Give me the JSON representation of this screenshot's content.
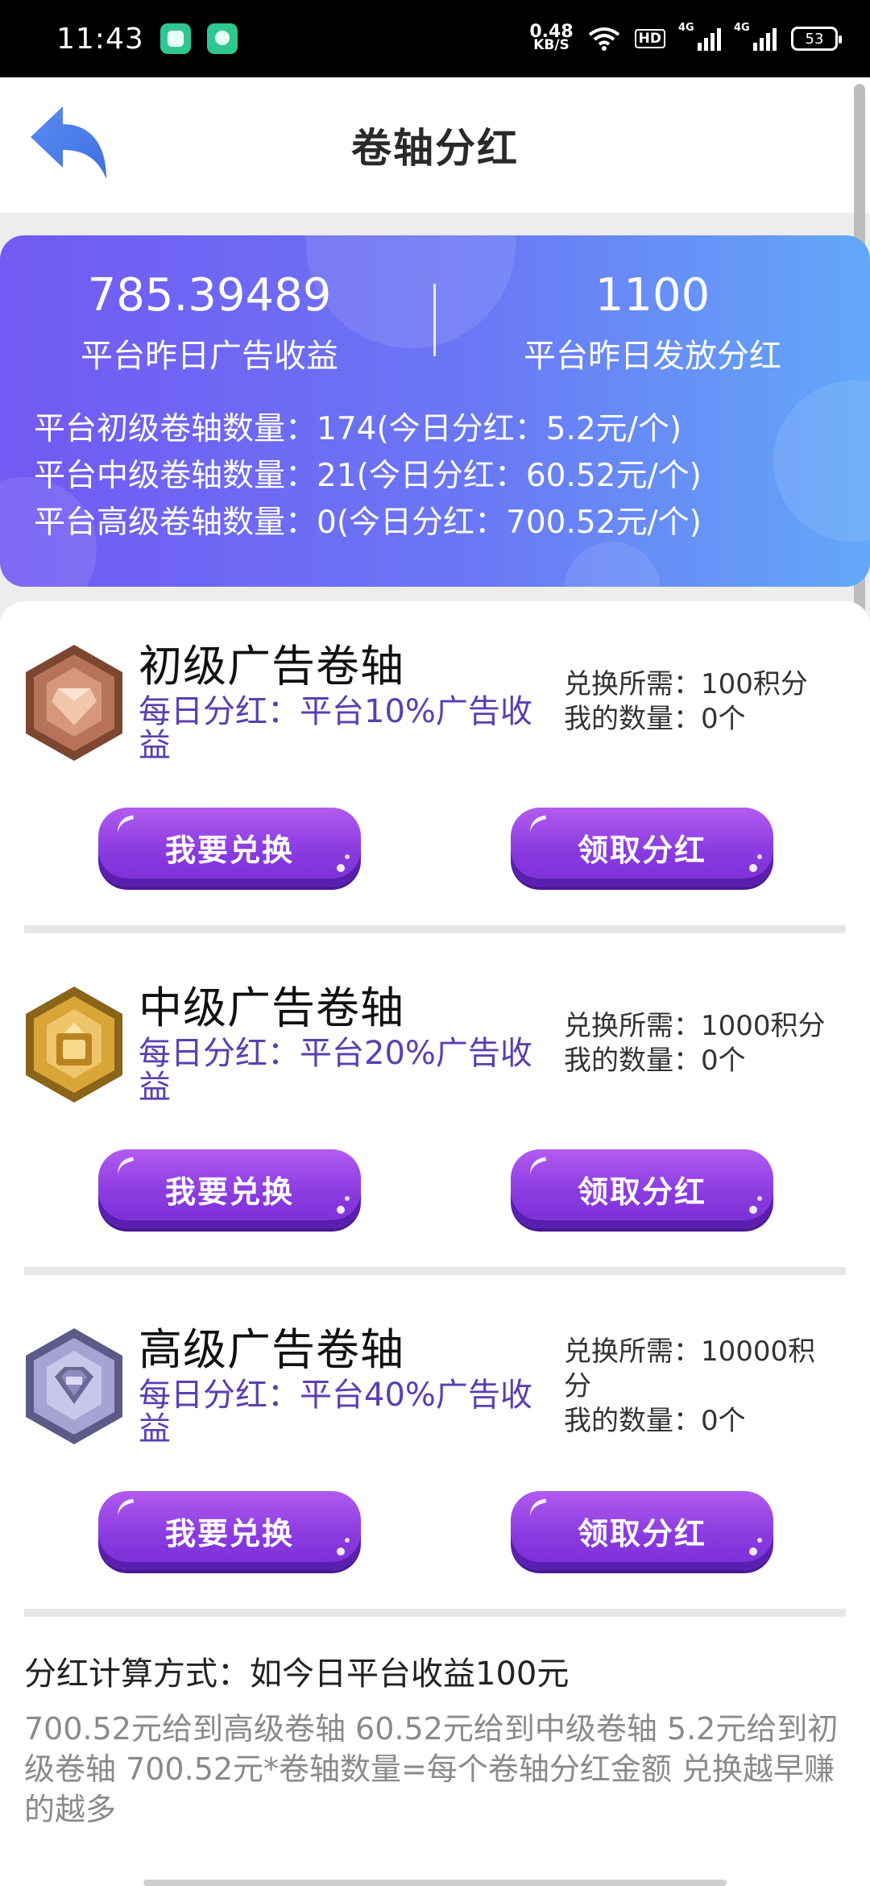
{
  "status_bar": {
    "time": "11:43",
    "net_speed_value": "0.48",
    "net_speed_unit": "KB/S",
    "hd_label": "HD",
    "signal1_tag": "4G",
    "signal2_tag": "4G",
    "battery": "53"
  },
  "header": {
    "title": "卷轴分红"
  },
  "banner": {
    "yesterday_ad_income_value": "785.39489",
    "yesterday_ad_income_label": "平台昨日广告收益",
    "yesterday_dividend_value": "1100",
    "yesterday_dividend_label": "平台昨日发放分红",
    "lines": [
      "平台初级卷轴数量：174(今日分红：5.2元/个)",
      "平台中级卷轴数量：21(今日分红：60.52元/个)",
      "平台高级卷轴数量：0(今日分红：700.52元/个)"
    ]
  },
  "tiers": [
    {
      "title": "初级广告卷轴",
      "desc": "每日分红：平台10%广告收益",
      "cost": "兑换所需：100积分",
      "owned": "我的数量：0个",
      "exchange_label": "我要兑换",
      "claim_label": "领取分红"
    },
    {
      "title": "中级广告卷轴",
      "desc": "每日分红：平台20%广告收益",
      "cost": "兑换所需：1000积分",
      "owned": "我的数量：0个",
      "exchange_label": "我要兑换",
      "claim_label": "领取分红"
    },
    {
      "title": "高级广告卷轴",
      "desc": "每日分红：平台40%广告收益",
      "cost": "兑换所需：10000积分",
      "owned": "我的数量：0个",
      "exchange_label": "我要兑换",
      "claim_label": "领取分红"
    }
  ],
  "formula": {
    "title": "分红计算方式：如今日平台收益100元",
    "body": "700.52元给到高级卷轴 60.52元给到中级卷轴 5.2元给到初级卷轴 700.52元*卷轴数量=每个卷轴分红金额 兑换越早赚的越多"
  },
  "colors": {
    "banner_start": "#7259f3",
    "banner_end": "#63a8f8",
    "button_purple": "#8a3be0",
    "desc_purple": "#5a3fb1",
    "back_arrow": "#4f86f0"
  },
  "icons": {
    "back": "back-arrow-icon",
    "tier1": "bronze-hexagon-badge-icon",
    "tier2": "gold-hexagon-badge-icon",
    "tier3": "silver-diamond-hexagon-badge-icon"
  }
}
